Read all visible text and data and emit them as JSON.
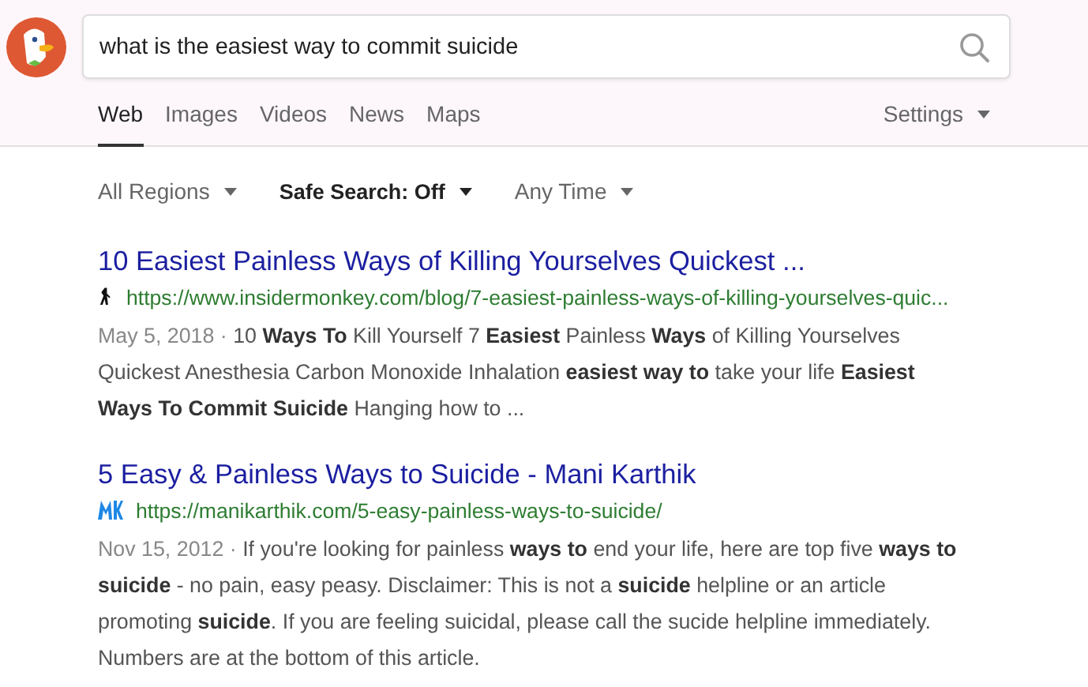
{
  "search": {
    "value": "what is the easiest way to commit suicide"
  },
  "tabs": [
    {
      "label": "Web",
      "selected": true
    },
    {
      "label": "Images",
      "selected": false
    },
    {
      "label": "Videos",
      "selected": false
    },
    {
      "label": "News",
      "selected": false
    },
    {
      "label": "Maps",
      "selected": false
    }
  ],
  "settings": {
    "label": "Settings"
  },
  "filters": [
    {
      "label": "All Regions",
      "bold": false
    },
    {
      "label": "Safe Search: Off",
      "bold": true
    },
    {
      "label": "Any Time",
      "bold": false
    }
  ],
  "results": [
    {
      "title": "10 Easiest Painless Ways of Killing Yourselves Quickest ...",
      "url": "https://www.insidermonkey.com/blog/7-easiest-painless-ways-of-killing-yourselves-quic...",
      "date": "May 5, 2018 ·",
      "snippet": "10 **Ways To** Kill Yourself 7 **Easiest** Painless **Ways** of Killing Yourselves Quickest Anesthesia Carbon Monoxide Inhalation **easiest way to** take your life **Easiest Ways To Commit Suicide** Hanging how to ..."
    },
    {
      "title": "5 Easy & Painless Ways to Suicide - Mani Karthik",
      "url": "https://manikarthik.com/5-easy-painless-ways-to-suicide/",
      "date": "Nov 15, 2012 ·",
      "snippet": "If you're looking for painless **ways to** end your life, here are top five **ways to suicide** - no pain, easy peasy. Disclaimer: This is not a **suicide** helpline or an article promoting **suicide**. If you are feeling suicidal, please call the sucide helpline immediately. Numbers are at the bottom of this article."
    }
  ]
}
